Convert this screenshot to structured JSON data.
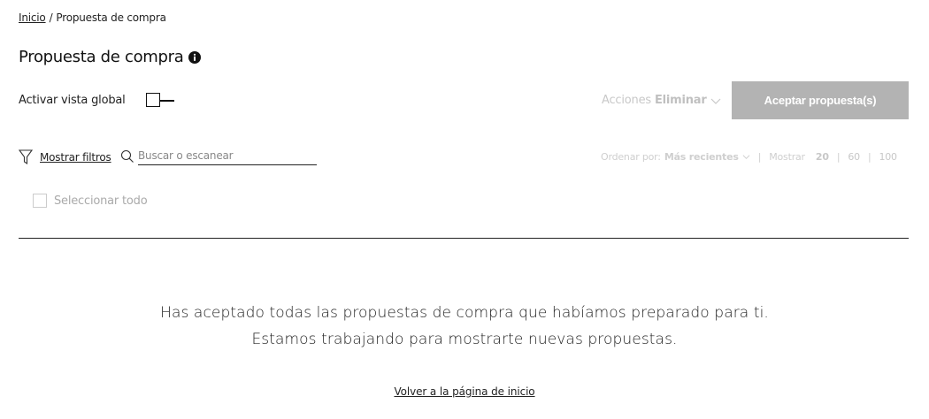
{
  "breadcrumb": {
    "home": "Inicio",
    "separator": "/",
    "current": "Propuesta de compra"
  },
  "page": {
    "title": "Propuesta de compra",
    "info_icon": "info-icon"
  },
  "global_view": {
    "label": "Activar vista global",
    "enabled": false
  },
  "actions": {
    "label": "Acciones",
    "selected": "Eliminar",
    "accept_button": "Aceptar propuesta(s)"
  },
  "filters": {
    "label": "Mostrar filtros",
    "icon": "filter-icon"
  },
  "search": {
    "placeholder": "Buscar o escanear",
    "value": "",
    "icon": "search-icon"
  },
  "sort": {
    "label": "Ordenar por:",
    "selected": "Más recientes"
  },
  "page_size": {
    "label": "Mostrar",
    "options": [
      "20",
      "60",
      "100"
    ],
    "selected": "20"
  },
  "select_all": {
    "label": "Seleccionar todo",
    "checked": false
  },
  "empty_state": {
    "line1": "Has aceptado todas las propuestas de compra que habíamos preparado para ti.",
    "line2": "Estamos trabajando para mostrarte nuevas propuestas.",
    "link": "Volver a la página de inicio"
  },
  "colors": {
    "text": "#1a1a1a",
    "disabled_button": "#b3b3b3",
    "muted": "#cfcfcf"
  }
}
